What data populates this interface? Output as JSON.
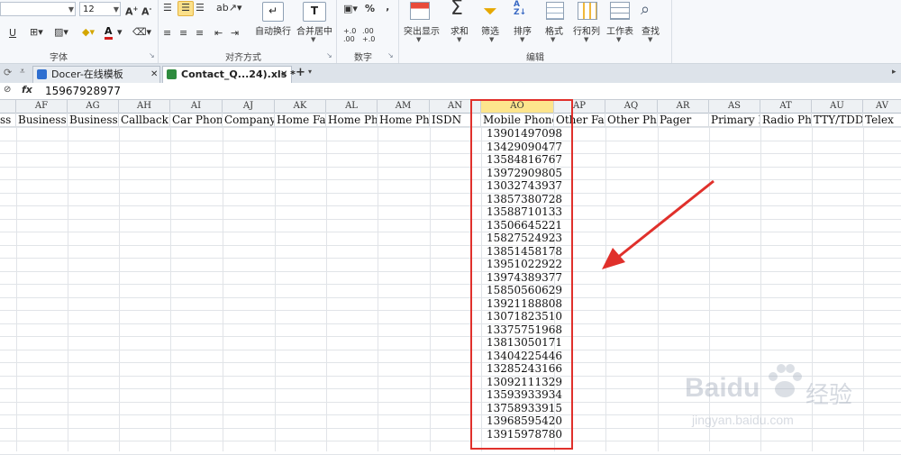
{
  "ribbon": {
    "font_size": "12",
    "font_group_label": "字体",
    "align_group_label": "对齐方式",
    "number_group_label": "数字",
    "edit_group_label": "编辑",
    "wrap_label": "自动换行",
    "merge_label": "合并居中",
    "highlight_label": "突出显示",
    "sum_label": "求和",
    "filter_label": "筛选",
    "sort_label": "排序",
    "format_label": "格式",
    "rowcol_label": "行和列",
    "sheet_label": "工作表",
    "find_label": "查找",
    "percent_glyph": "%",
    "thousand_glyph": "‚",
    "dec_inc": "+.0 .00",
    "dec_dec": ".00 +.0",
    "underline_glyph": "U"
  },
  "tabs": [
    {
      "label": "Docer-在线模板"
    },
    {
      "label": "Contact_Q...24).xls *"
    }
  ],
  "formula_bar": {
    "fx": "fx",
    "value": "15967928977"
  },
  "columns": [
    {
      "letter": "AF",
      "header": "Business"
    },
    {
      "letter": "AG",
      "header": "Business"
    },
    {
      "letter": "AH",
      "header": "Callback"
    },
    {
      "letter": "AI",
      "header": "Car Phone"
    },
    {
      "letter": "AJ",
      "header": "Company M"
    },
    {
      "letter": "AK",
      "header": "Home Fax"
    },
    {
      "letter": "AL",
      "header": "Home Phon"
    },
    {
      "letter": "AM",
      "header": "Home Phon"
    },
    {
      "letter": "AN",
      "header": "ISDN"
    },
    {
      "letter": "AO",
      "header": "Mobile Phone"
    },
    {
      "letter": "AP",
      "header": "Other Fax"
    },
    {
      "letter": "AQ",
      "header": "Other Pho"
    },
    {
      "letter": "AR",
      "header": "Pager"
    },
    {
      "letter": "AS",
      "header": "Primary P"
    },
    {
      "letter": "AT",
      "header": "Radio Pho"
    },
    {
      "letter": "AU",
      "header": "TTY/TDD P"
    },
    {
      "letter": "AV",
      "header": "Telex"
    }
  ],
  "first_partial_header": "ss",
  "mobile_values": [
    "13901497098",
    "13429090477",
    "13584816767",
    "13972909805",
    "13032743937",
    "13857380728",
    "13588710133",
    "13506645221",
    "15827524923",
    "13851458178",
    "13951022922",
    "13974389377",
    "15850560629",
    "13921188808",
    "13071823510",
    "13375751968",
    "13813050171",
    "13404225446",
    "13285243166",
    "13092111329",
    "13593933934",
    "13758933915",
    "13968595420",
    "13915978780"
  ],
  "watermark": {
    "brand": "Baidu",
    "jingyan_cn": "经验",
    "url": "jingyan.baidu.com"
  },
  "colors": {
    "highlight": "#e0302b",
    "selected_col": "#fde58d"
  }
}
